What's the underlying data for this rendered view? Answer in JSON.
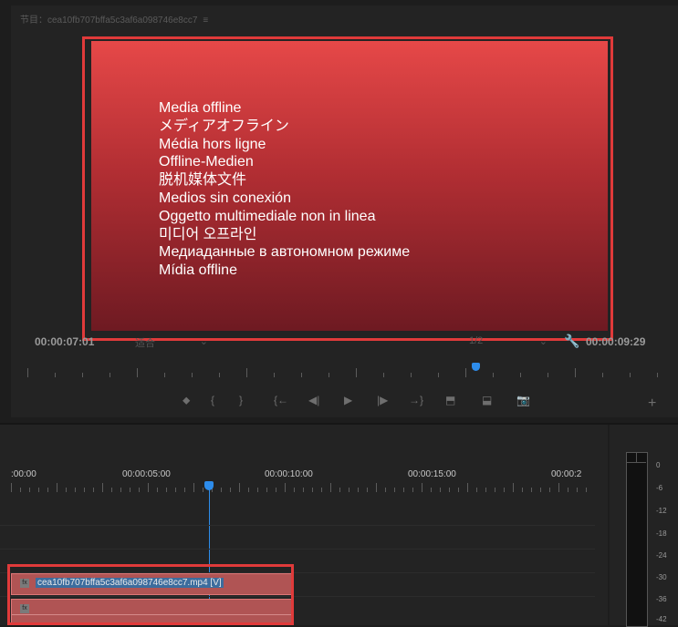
{
  "program_monitor": {
    "title": "节目：cea10fb707bffa5c3af6a098746e8cc7",
    "menu_icon": "hamburger-icon",
    "offline_lines": [
      "Media offline",
      "メディアオフライン",
      "Média hors ligne",
      "Offline-Medien",
      "脱机媒体文件",
      "Medios sin conexión",
      "Oggetto multimediale non in linea",
      "미디어 오프라인",
      "Медиаданные в автономном режиме",
      "Mídia offline"
    ],
    "current_timecode": "00:00:07:01",
    "fit_label": "适合",
    "resolution_label": "1/2",
    "duration_timecode": "00:00:09:29",
    "playhead_fraction": 0.69
  },
  "transport": {
    "marker": "⬥",
    "mark_in": "{",
    "mark_out": "}",
    "go_to_in": "{←",
    "step_back": "◀|",
    "play": "▶",
    "step_forward": "|▶",
    "go_to_out": "→}",
    "lift": "⬒",
    "extract": "⬓",
    "export_frame": "📷",
    "add": "+"
  },
  "timeline": {
    "ruler_labels": [
      ":00:00",
      "00:00:05:00",
      "00:00:10:00",
      "00:00:15:00",
      "00:00:2"
    ],
    "playhead_time": "00:00:07:01",
    "clip_name": "cea10fb707bffa5c3af6a098746e8cc7.mp4 [V]",
    "clip_fx": "fx"
  },
  "audio_meter": {
    "labels": [
      "0",
      "-6",
      "-12",
      "-18",
      "-24",
      "-30",
      "-36",
      "-42"
    ]
  },
  "colors": {
    "accent": "#2d8ceb",
    "highlight_box": "#e03a3a",
    "clip": "#b05454"
  }
}
